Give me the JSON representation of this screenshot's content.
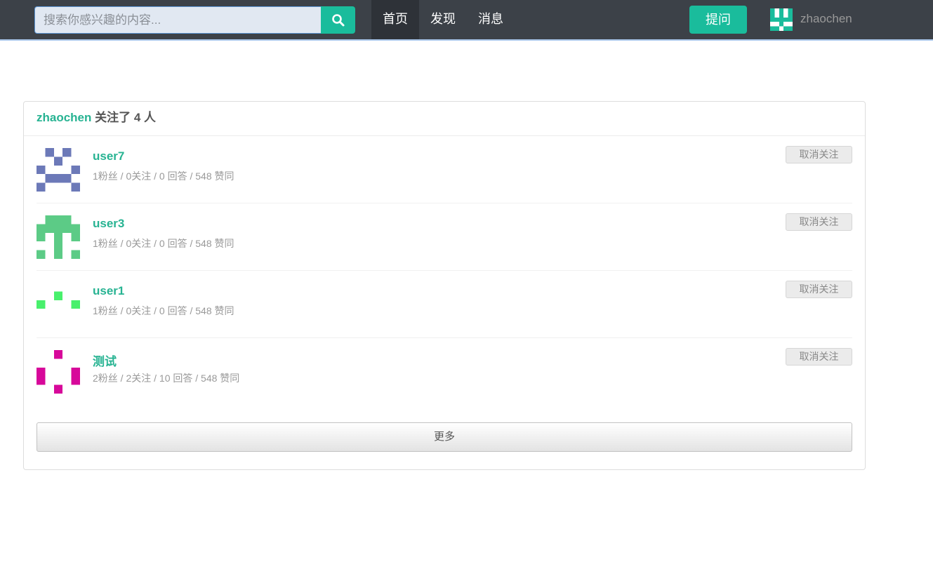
{
  "search": {
    "placeholder": "搜索你感兴趣的内容...",
    "value": ""
  },
  "nav": {
    "items": [
      {
        "label": "首页"
      },
      {
        "label": "发现"
      },
      {
        "label": "消息"
      }
    ]
  },
  "header": {
    "ask_label": "提问",
    "username": "zhaochen"
  },
  "panel": {
    "username": "zhaochen",
    "title_suffix": " 关注了 4 人"
  },
  "following": [
    {
      "name": "user7",
      "stats": "1粉丝 / 0关注 / 0 回答 / 548 赞同",
      "unfollow": "取消关注",
      "avatar_color": "#6c79b8"
    },
    {
      "name": "user3",
      "stats": "1粉丝 / 0关注 / 0 回答 / 548 赞同",
      "unfollow": "取消关注",
      "avatar_color": "#5ccb86"
    },
    {
      "name": "user1",
      "stats": "1粉丝 / 0关注 / 0 回答 / 548 赞同",
      "unfollow": "取消关注",
      "avatar_color": "#48f06c"
    },
    {
      "name": "测试",
      "stats": "2粉丝 / 2关注 / 10 回答 / 548 赞同",
      "unfollow": "取消关注",
      "avatar_color": "#d7089a"
    }
  ],
  "more_label": "更多",
  "colors": {
    "accent": "#1abc9c",
    "link": "#27b392",
    "topbar": "#3c4148",
    "user_avatar": "#1abc9c"
  }
}
